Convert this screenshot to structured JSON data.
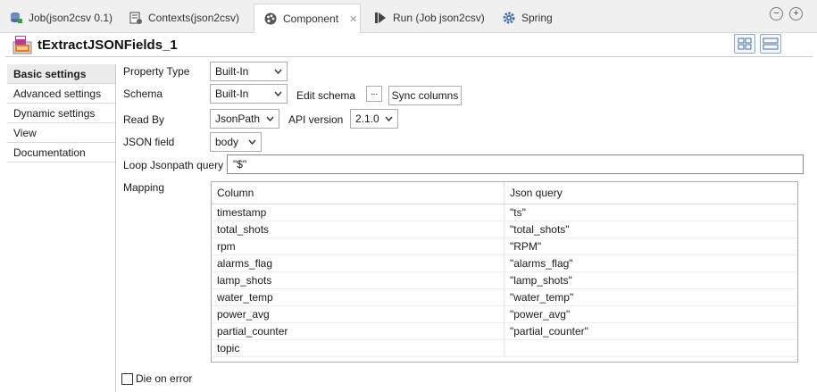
{
  "tabs": [
    {
      "label": "Job(json2csv 0.1)",
      "icon": "job-icon",
      "active": false
    },
    {
      "label": "Contexts(json2csv)",
      "icon": "contexts-icon",
      "active": false
    },
    {
      "label": "Component",
      "icon": "component-icon",
      "active": true
    },
    {
      "label": "Run (Job json2csv)",
      "icon": "run-icon",
      "active": false
    },
    {
      "label": "Spring",
      "icon": "gear-icon",
      "active": false
    }
  ],
  "window_controls": {
    "minimize": "−",
    "maximize": "+"
  },
  "component": {
    "title": "tExtractJSONFields_1"
  },
  "nav": {
    "items": [
      {
        "label": "Basic settings",
        "active": true
      },
      {
        "label": "Advanced settings",
        "active": false
      },
      {
        "label": "Dynamic settings",
        "active": false
      },
      {
        "label": "View",
        "active": false
      },
      {
        "label": "Documentation",
        "active": false
      }
    ]
  },
  "form": {
    "property_type": {
      "label": "Property Type",
      "value": "Built-In"
    },
    "schema": {
      "label": "Schema",
      "value": "Built-In",
      "edit_label": "Edit schema",
      "ellipsis": "...",
      "sync_label": "Sync columns"
    },
    "read_by": {
      "label": "Read By",
      "value": "JsonPath",
      "api_label": "API version",
      "api_value": "2.1.0"
    },
    "json_field": {
      "label": "JSON field",
      "value": "body"
    },
    "loop_jsonpath": {
      "label": "Loop Jsonpath query",
      "value": "\"$\""
    },
    "mapping": {
      "label": "Mapping"
    },
    "die_on_error": {
      "label": "Die on error",
      "checked": false
    }
  },
  "mapping_table": {
    "headers": [
      "Column",
      "Json query"
    ],
    "rows": [
      {
        "column": "timestamp",
        "query": "\"ts\""
      },
      {
        "column": "total_shots",
        "query": "\"total_shots\""
      },
      {
        "column": "rpm",
        "query": "\"RPM\""
      },
      {
        "column": "alarms_flag",
        "query": "\"alarms_flag\""
      },
      {
        "column": "lamp_shots",
        "query": "\"lamp_shots\""
      },
      {
        "column": "water_temp",
        "query": "\"water_temp\""
      },
      {
        "column": "power_avg",
        "query": "\"power_avg\""
      },
      {
        "column": "partial_counter",
        "query": "\"partial_counter\""
      },
      {
        "column": "topic",
        "query": ""
      }
    ]
  }
}
